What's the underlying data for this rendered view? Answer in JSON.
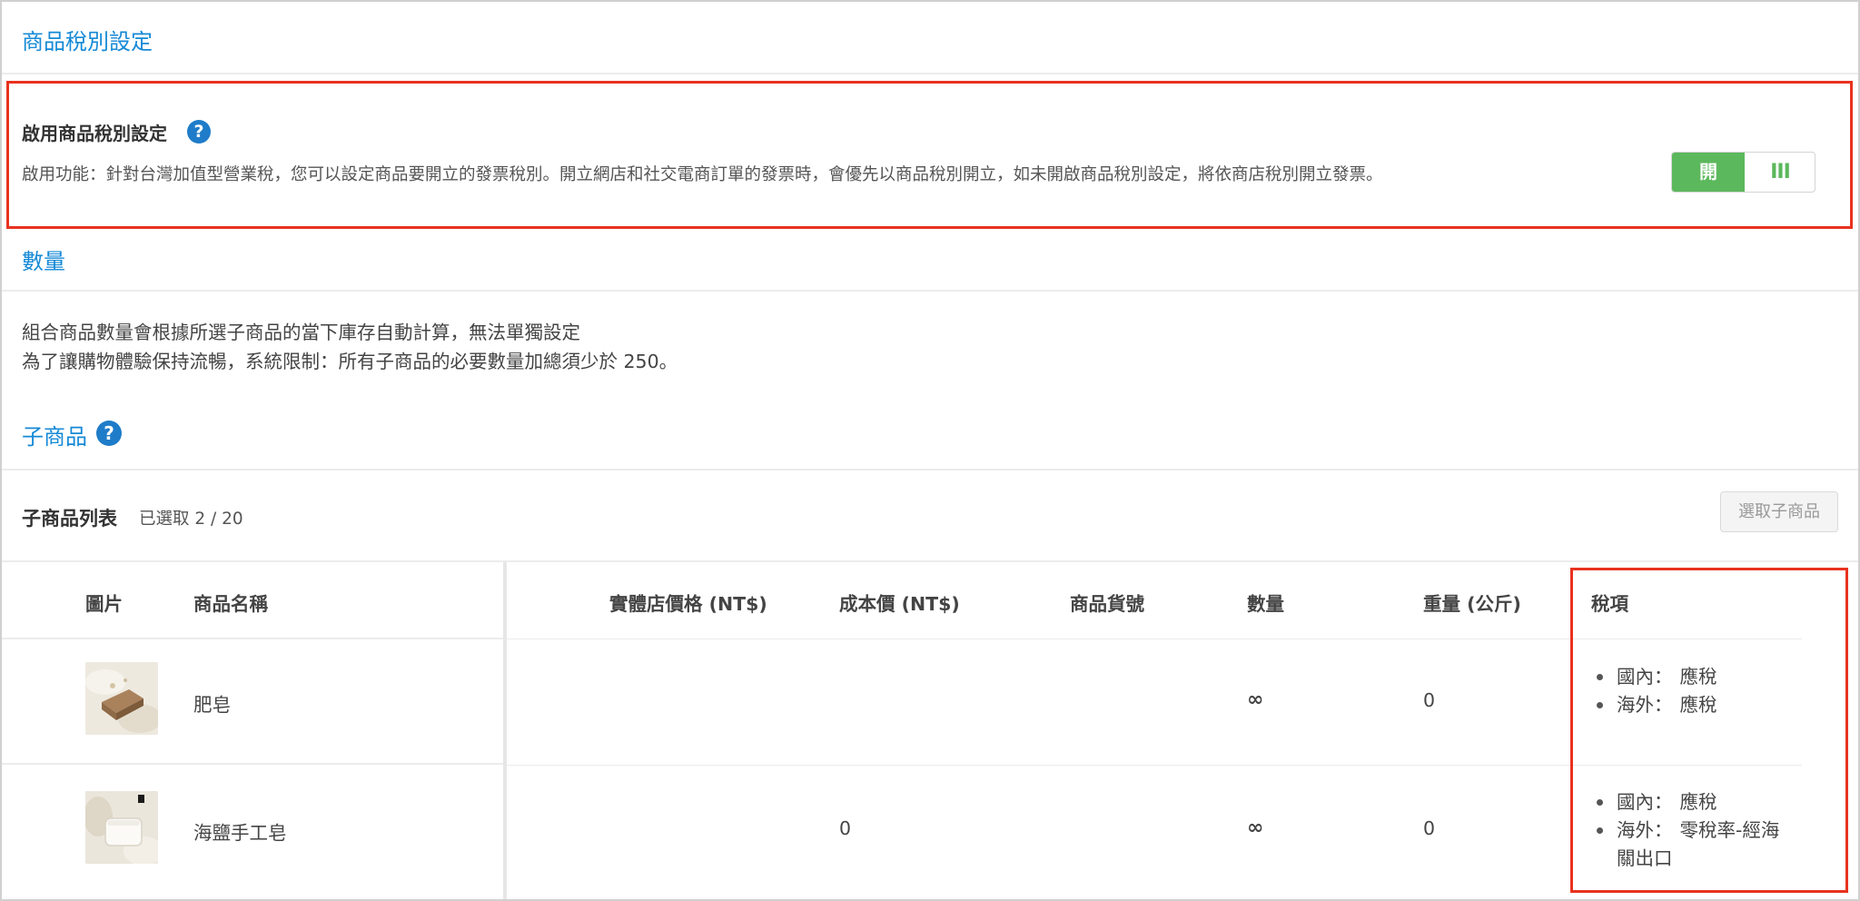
{
  "tax_settings": {
    "section_title": "商品稅別設定",
    "enable_label": "啟用商品稅別設定",
    "help_glyph": "?",
    "description": "啟用功能：針對台灣加值型營業稅，您可以設定商品要開立的發票稅別。開立網店和社交電商訂單的發票時，會優先以商品稅別開立，如未開啟商品稅別設定，將依商店稅別開立發票。",
    "toggle_on_label": "開",
    "toggle_handle": "III",
    "toggle_state": "on"
  },
  "quantity": {
    "section_title": "數量",
    "line1": "組合商品數量會根據所選子商品的當下庫存自動計算，無法單獨設定",
    "line2": "為了讓購物體驗保持流暢，系統限制：所有子商品的必要數量加總須少於 250。"
  },
  "sub_products": {
    "section_title": "子商品",
    "help_glyph": "?",
    "list_title": "子商品列表",
    "selected_count": "已選取 2 / 20",
    "select_button": "選取子商品",
    "columns": [
      "圖片",
      "商品名稱",
      "實體店價格 (NT$)",
      "成本價 (NT$)",
      "商品貨號",
      "數量",
      "重量 (公斤)",
      "稅項"
    ],
    "rows": [
      {
        "name": "肥皂",
        "store_price": "",
        "cost_price": "",
        "sku": "",
        "quantity": "∞",
        "weight": "0",
        "tax": [
          {
            "key": "國內：",
            "value": "應稅"
          },
          {
            "key": "海外：",
            "value": "應稅"
          }
        ]
      },
      {
        "name": "海鹽手工皂",
        "store_price": "",
        "cost_price": "0",
        "sku": "",
        "quantity": "∞",
        "weight": "0",
        "tax": [
          {
            "key": "國內：",
            "value": "應稅"
          },
          {
            "key": "海外：",
            "value": "零稅率-經海關出口"
          }
        ]
      }
    ]
  },
  "colors": {
    "link_blue": "#1589d6",
    "toggle_green": "#5cb85c",
    "highlight_red": "#e8321f"
  }
}
